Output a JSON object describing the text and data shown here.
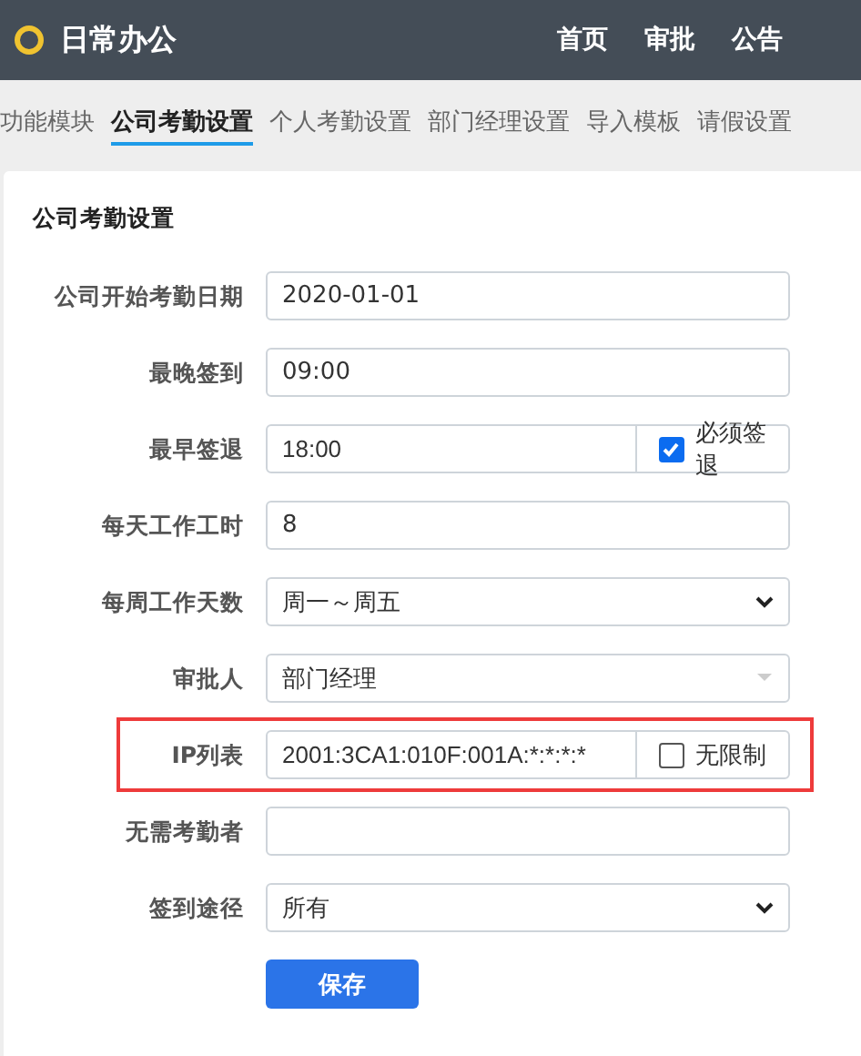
{
  "header": {
    "app_name": "日常办公",
    "nav": [
      "首页",
      "审批",
      "公告"
    ]
  },
  "tabs": [
    {
      "label": "功能模块",
      "selected": false
    },
    {
      "label": "公司考勤设置",
      "selected": true
    },
    {
      "label": "个人考勤设置",
      "selected": false
    },
    {
      "label": "部门经理设置",
      "selected": false
    },
    {
      "label": "导入模板",
      "selected": false
    },
    {
      "label": "请假设置",
      "selected": false
    }
  ],
  "card": {
    "title": "公司考勤设置",
    "fields": [
      {
        "kind": "text",
        "label": "公司开始考勤日期",
        "value": "2020-01-01",
        "highlighted": false
      },
      {
        "kind": "text",
        "label": "最晚签到",
        "value": "09:00",
        "highlighted": false
      },
      {
        "kind": "check",
        "label": "最早签退",
        "value": "18:00",
        "check_label": "必须签退",
        "checked": true,
        "highlighted": false
      },
      {
        "kind": "text",
        "label": "每天工作工时",
        "value": "8",
        "highlighted": false
      },
      {
        "kind": "select",
        "label": "每周工作天数",
        "value": "周一～周五",
        "disabled": false,
        "highlighted": false
      },
      {
        "kind": "select",
        "label": "审批人",
        "value": "部门经理",
        "disabled": true,
        "highlighted": false
      },
      {
        "kind": "check",
        "label": "IP列表",
        "value": "2001:3CA1:010F:001A:*:*:*:*",
        "check_label": "无限制",
        "checked": false,
        "highlighted": true
      },
      {
        "kind": "text",
        "label": "无需考勤者",
        "highlighted": false
      },
      {
        "kind": "select",
        "label": "签到途径",
        "value": "所有",
        "disabled": false,
        "highlighted": false
      }
    ],
    "save_button": "保存"
  }
}
